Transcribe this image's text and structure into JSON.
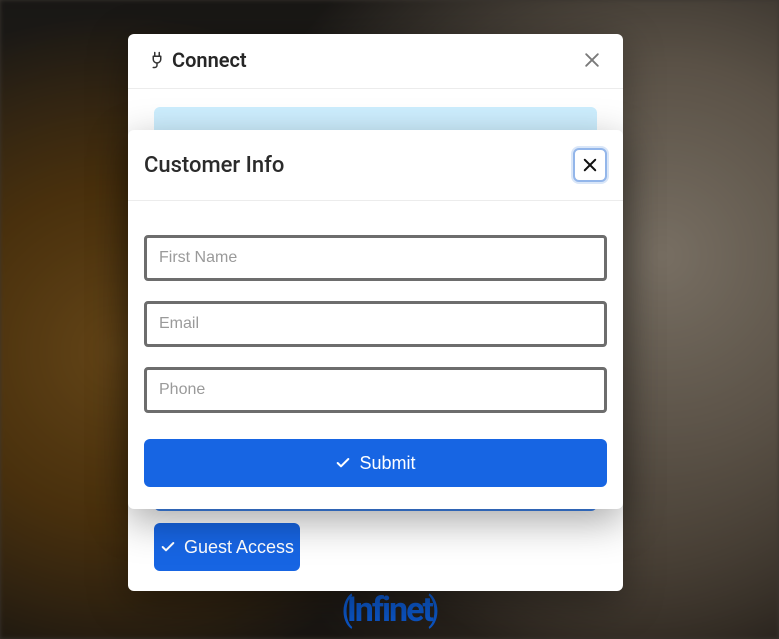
{
  "back_dialog": {
    "title": "Connect",
    "guest_button": "Guest Access"
  },
  "front_dialog": {
    "title": "Customer Info",
    "fields": {
      "first_name_placeholder": "First Name",
      "email_placeholder": "Email",
      "phone_placeholder": "Phone"
    },
    "submit_label": "Submit"
  },
  "brand_text": "Infinet"
}
